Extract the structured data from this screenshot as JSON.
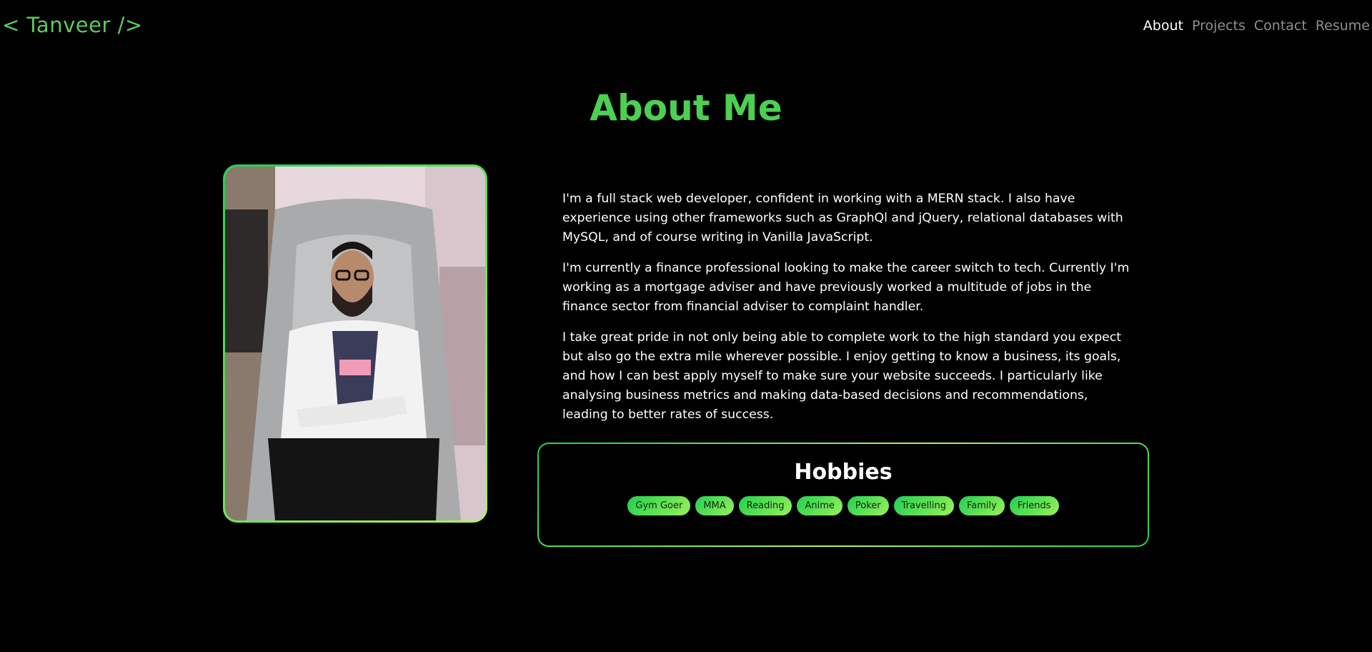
{
  "nav": {
    "logo": "< Tanveer />",
    "links": [
      {
        "label": "About",
        "active": true
      },
      {
        "label": "Projects",
        "active": false
      },
      {
        "label": "Contact",
        "active": false
      },
      {
        "label": "Resume",
        "active": false
      }
    ]
  },
  "about": {
    "title": "About Me",
    "paragraphs": [
      "I'm a full stack web developer, confident in working with a MERN stack. I also have experience using other frameworks such as GraphQl and jQuery, relational databases with MySQL, and of course writing in Vanilla JavaScript.",
      "I'm currently a finance professional looking to make the career switch to tech. Currently I'm working as a mortgage adviser and have previously worked a multitude of jobs in the finance sector from financial adviser to complaint handler.",
      "I take great pride in not only being able to complete work to the high standard you expect but also go the extra mile wherever possible. I enjoy getting to know a business, its goals, and how I can best apply myself to make sure your website succeeds. I particularly like analysing business metrics and making data-based decisions and recommendations, leading to better rates of success."
    ]
  },
  "hobbies": {
    "title": "Hobbies",
    "items": [
      "Gym Goer",
      "MMA",
      "Reading",
      "Anime",
      "Poker",
      "Travelling",
      "Family",
      "Friends"
    ]
  },
  "colors": {
    "background": "#000000",
    "accent_green": "#4cd052",
    "gradient_start": "#22d152",
    "gradient_end": "#b4f25e",
    "nav_inactive": "#8f8f8f",
    "nav_active": "#ffffff"
  }
}
